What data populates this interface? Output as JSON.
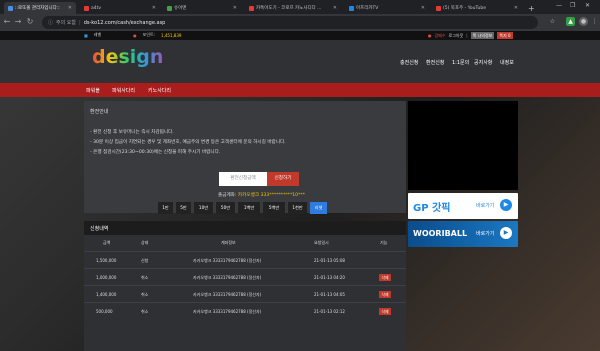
{
  "browser": {
    "tabs": [
      {
        "title": "::로또볼 관리자입니다::",
        "active": true,
        "color": "#4a8fe7"
      },
      {
        "title": "a4tv",
        "active": false,
        "color": "#e53935"
      },
      {
        "title": "슈어맨",
        "active": false,
        "color": "#43a047"
      },
      {
        "title": "카톡아도기 - 코로프 카노사디다 ...",
        "active": false,
        "color": "#e53935"
      },
      {
        "title": "아프리카TV",
        "active": false,
        "color": "#1e88e5"
      },
      {
        "title": "(5) 북포주 - YouTube",
        "active": false,
        "color": "#e53935"
      }
    ],
    "new_tab": "+",
    "url_warning": "주의 요함",
    "url": "ds-ko12.com/cash/exchange.asp"
  },
  "site": {
    "topbar": {
      "level_label": "레벨",
      "points_label": "포인트:",
      "points_value": "1,451,839",
      "user_label": "강패수",
      "logout": "로그아웃",
      "mypage": "쪽 나의정보",
      "register": "쪽지 0"
    },
    "logo": "design",
    "main_nav": [
      "충전신청",
      "환전신청",
      "1:1문의",
      "공지사항",
      "내정보"
    ],
    "sub_nav": [
      "파워볼",
      "파워사다리",
      "키노사다리"
    ],
    "panel_title": "환전안내",
    "notices": [
      "- 환전 신청 후 보유머니는 즉시 차감됩니다.",
      "- 30분 이상 입금이 지연되는 경우 및 계좌번호, 예금주의 변경 등은 고객센터에 문의 하시길 바랍니다.",
      "- 은행 점검시간(23:30~00:30)에는 신청을 피해 주시기 바랍니다."
    ],
    "amount_placeholder": "환전신청금액",
    "apply_button": "신청하기",
    "account_label": "출금계좌:",
    "account_value": "카카오뱅크 333**********10***",
    "amount_buttons": [
      "1만",
      "5만",
      "10만",
      "50만",
      "1백만",
      "5백만",
      "1천만",
      "리셋"
    ],
    "list_title": "신청내역",
    "table": {
      "headers": [
        "금액",
        "상태",
        "계좌정보",
        "요청일시",
        "기능"
      ],
      "rows": [
        {
          "amount": "1,500,000",
          "status": "신청",
          "account": "카카오뱅크 3333179462788 (정선자)",
          "date": "21-01-13 05:08",
          "action": ""
        },
        {
          "amount": "1,000,000",
          "status": "취소",
          "account": "카카오뱅크 3333179462788 (정선자)",
          "date": "21-01-13 04:20",
          "action": "삭제"
        },
        {
          "amount": "1,400,000",
          "status": "취소",
          "account": "카카오뱅크 3333179462788 (정선자)",
          "date": "21-01-13 04:05",
          "action": "삭제"
        },
        {
          "amount": "500,000",
          "status": "취소",
          "account": "카카오뱅크 3333179462788 (정선자)",
          "date": "21-01-13 02:12",
          "action": "삭제"
        }
      ]
    },
    "banners": [
      {
        "title": "GP 갓픽",
        "go": "바로가기",
        "play": "▶"
      },
      {
        "title": "WOORIBALL",
        "go": "바로가기",
        "play": "▶"
      }
    ]
  }
}
